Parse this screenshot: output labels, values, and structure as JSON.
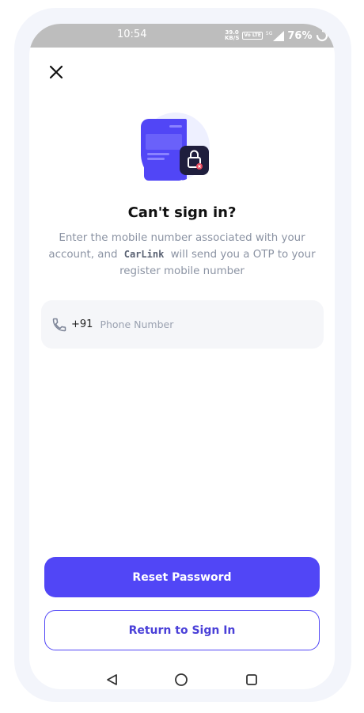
{
  "status_bar": {
    "time": "10:54",
    "net_speed_value": "39.0",
    "net_speed_unit": "KB/S",
    "volte_label": "Vo LTE",
    "network_label": "5G",
    "battery_percent": "76%"
  },
  "header": {
    "close_icon": "close-icon"
  },
  "illustration": {
    "name": "locked-phone-illustration",
    "accent_color": "#5146f6"
  },
  "content": {
    "title": "Can't sign in?",
    "description_before": "Enter the mobile number associated with your account, and",
    "brand": "CarLink",
    "description_after": "will send you a OTP to your register mobile number"
  },
  "phone_field": {
    "icon": "phone-icon",
    "country_code": "+91",
    "value": "",
    "placeholder": "Phone Number"
  },
  "actions": {
    "reset_label": "Reset Password",
    "return_label": "Return to Sign In"
  },
  "nav_bar": {
    "back_icon": "back-triangle-icon",
    "home_icon": "home-circle-icon",
    "recents_icon": "recents-square-icon"
  },
  "colors": {
    "primary": "#5146f6",
    "status_bar": "#bdbdbd",
    "field_background": "#f5f6f9",
    "muted_text": "#8b93a3"
  }
}
